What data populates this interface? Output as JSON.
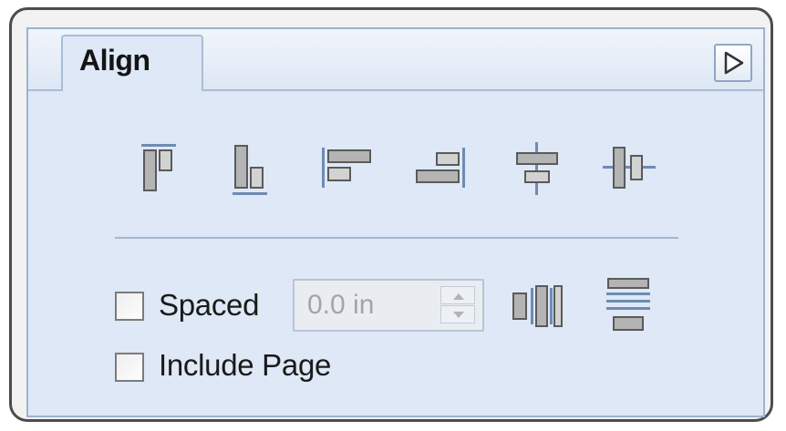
{
  "tabs": {
    "active": "Align"
  },
  "menu": {
    "icon": "panel-menu-arrow-icon"
  },
  "align_buttons": [
    {
      "name": "align-top-icon"
    },
    {
      "name": "align-bottom-icon"
    },
    {
      "name": "align-left-icon"
    },
    {
      "name": "align-right-icon"
    },
    {
      "name": "align-horizontal-center-icon"
    },
    {
      "name": "align-vertical-center-icon"
    }
  ],
  "options": {
    "spaced_label": "Spaced",
    "spaced_checked": false,
    "spacing_value": "0.0 in",
    "include_page_label": "Include Page",
    "include_page_checked": false
  },
  "distribute_buttons": [
    {
      "name": "distribute-horizontal-icon"
    },
    {
      "name": "distribute-vertical-icon"
    }
  ],
  "colors": {
    "panel_bg": "#dee8f6",
    "border": "#9db3cf",
    "icon_fill": "#b4b4b4",
    "icon_stroke": "#5a5a5a",
    "guide_blue": "#6f8bb3"
  }
}
